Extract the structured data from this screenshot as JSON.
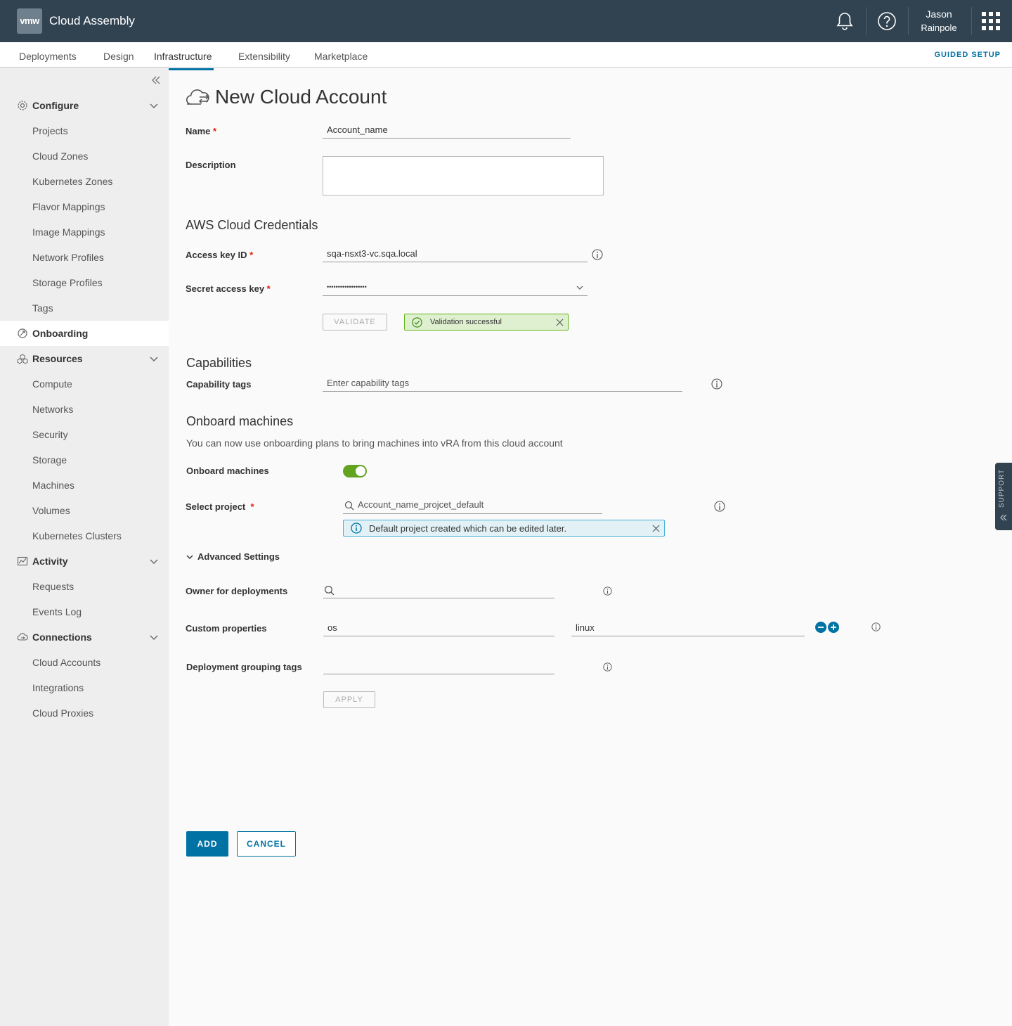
{
  "header": {
    "logo_text": "vmw",
    "app_title": "Cloud Assembly",
    "user_first": "Jason",
    "user_last": "Rainpole"
  },
  "nav": {
    "tabs": [
      {
        "label": "Deployments"
      },
      {
        "label": "Design"
      },
      {
        "label": "Infrastructure"
      },
      {
        "label": "Extensibility"
      },
      {
        "label": "Marketplace"
      }
    ],
    "active_tab": "Infrastructure",
    "guided_setup": "GUIDED SETUP"
  },
  "sidebar": {
    "configure": {
      "label": "Configure",
      "items": [
        "Projects",
        "Cloud Zones",
        "Kubernetes Zones",
        "Flavor Mappings",
        "Image Mappings",
        "Network Profiles",
        "Storage Profiles",
        "Tags"
      ]
    },
    "onboarding": {
      "label": "Onboarding"
    },
    "resources": {
      "label": "Resources",
      "items": [
        "Compute",
        "Networks",
        "Security",
        "Storage",
        "Machines",
        "Volumes",
        "Kubernetes Clusters"
      ]
    },
    "activity": {
      "label": "Activity",
      "items": [
        "Requests",
        "Events Log"
      ]
    },
    "connections": {
      "label": "Connections",
      "items": [
        "Cloud Accounts",
        "Integrations",
        "Cloud Proxies"
      ]
    }
  },
  "form": {
    "title": "New Cloud Account",
    "name_label": "Name",
    "name_value": "Account_name",
    "description_label": "Description",
    "description_value": "",
    "aws_section": "AWS Cloud Credentials",
    "access_key_label": "Access key ID",
    "access_key_value": "sqa-nsxt3-vc.sqa.local",
    "secret_key_label": "Secret access key",
    "secret_key_value": "••••••••••••••••••",
    "validate_button": "VALIDATE",
    "validation_message": "Validation successful",
    "capabilities_section": "Capabilities",
    "capability_tags_label": "Capability tags",
    "capability_tags_placeholder": "Enter capability tags",
    "onboard_section": "Onboard machines",
    "onboard_description": "You can now use onboarding plans to bring machines into vRA from this cloud account",
    "onboard_toggle_label": "Onboard machines",
    "onboard_toggle_on": true,
    "select_project_label": "Select project",
    "select_project_value": "Account_name_projcet_default",
    "project_info": "Default project created which can be edited later.",
    "advanced_settings": "Advanced Settings",
    "owner_label": "Owner for deployments",
    "owner_value": "",
    "custom_props_label": "Custom properties",
    "custom_prop_key": "os",
    "custom_prop_value": "linux",
    "grouping_tags_label": "Deployment grouping tags",
    "grouping_tags_value": "",
    "apply_button": "APPLY",
    "add_button": "ADD",
    "cancel_button": "CANCEL"
  },
  "support_tab": "SUPPORT",
  "colors": {
    "header_bg": "#314351",
    "accent": "#0072a3",
    "success": "#60b515",
    "info": "#49afd9",
    "toggle_on": "#62a420"
  }
}
